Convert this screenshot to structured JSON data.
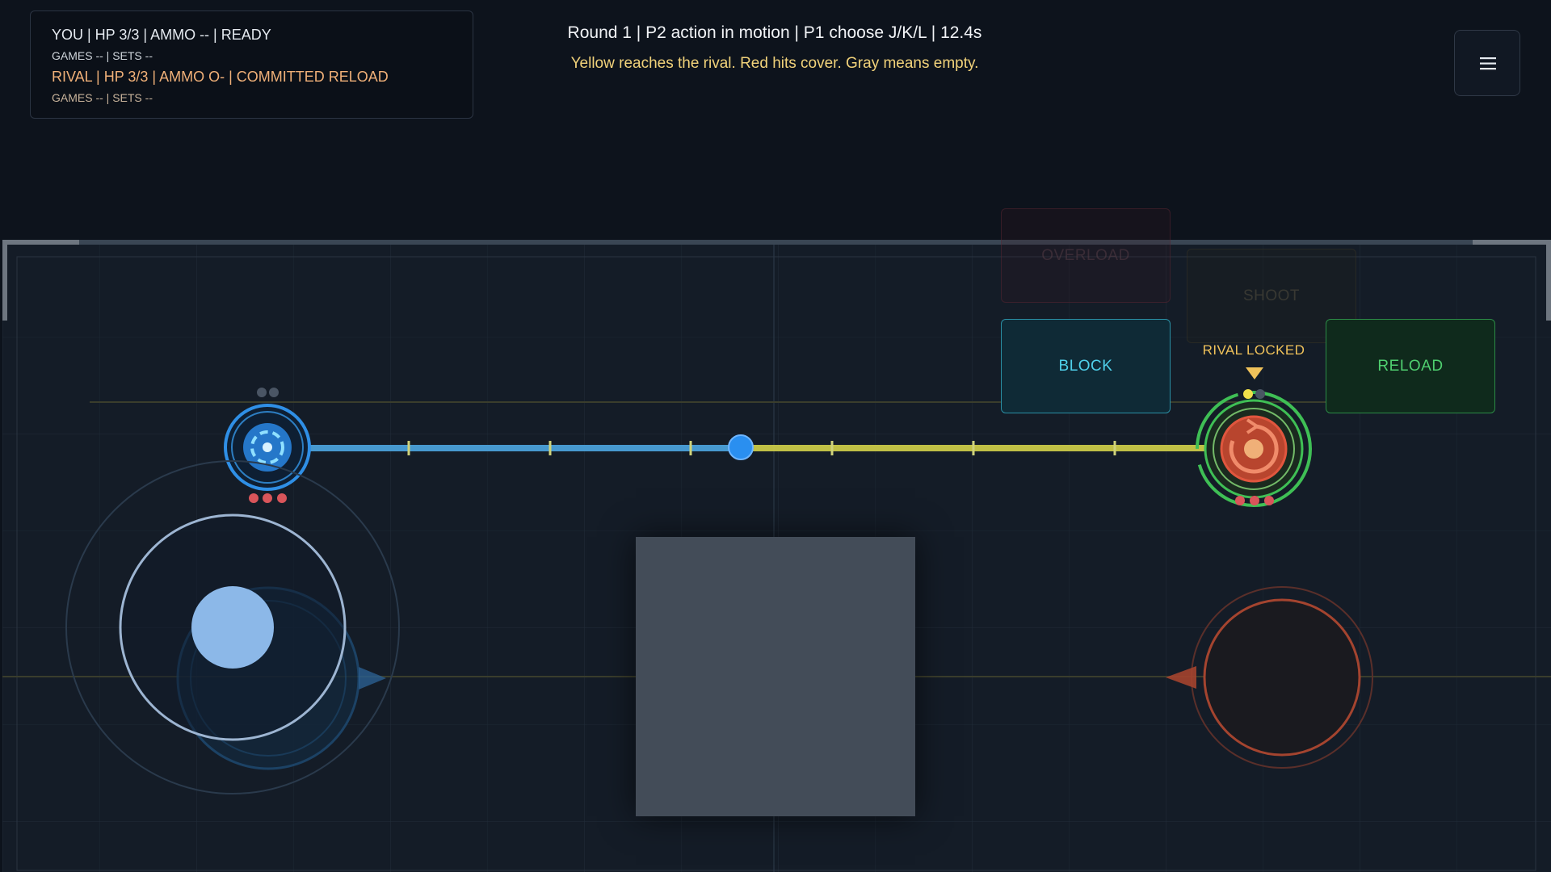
{
  "hud": {
    "you_line": "YOU | HP 3/3 | AMMO -- | READY",
    "you_sub": "GAMES -- | SETS --",
    "rival_line": "RIVAL | HP 3/3 | AMMO O- | COMMITTED RELOAD",
    "rival_sub": "GAMES -- | SETS --",
    "round_line": "Round 1 | P2 action in motion | P1 choose J/K/L | 12.4s",
    "hint_line": "Yellow reaches the rival. Red hits cover. Gray means empty."
  },
  "menu": {
    "icon": "hamburger-icon"
  },
  "actions": {
    "overload": "OVERLOAD",
    "shoot": "SHOOT",
    "block": "BLOCK",
    "reload": "RELOAD"
  },
  "rival_marker": {
    "label": "RIVAL LOCKED"
  },
  "colors": {
    "player": "#2f8fe6",
    "rival": "#e0563e",
    "aim_line_player": "#4aa0d8",
    "aim_line_rival": "#d3d24a",
    "block": "#4fd0ea",
    "reload": "#4fcf6f",
    "locked": "#f0c25a"
  },
  "player": {
    "hp_pips": 3,
    "ammo_pips": 2
  },
  "rival": {
    "hp_pips": 3,
    "ammo_pips": 2,
    "ammo_loaded": 1
  }
}
